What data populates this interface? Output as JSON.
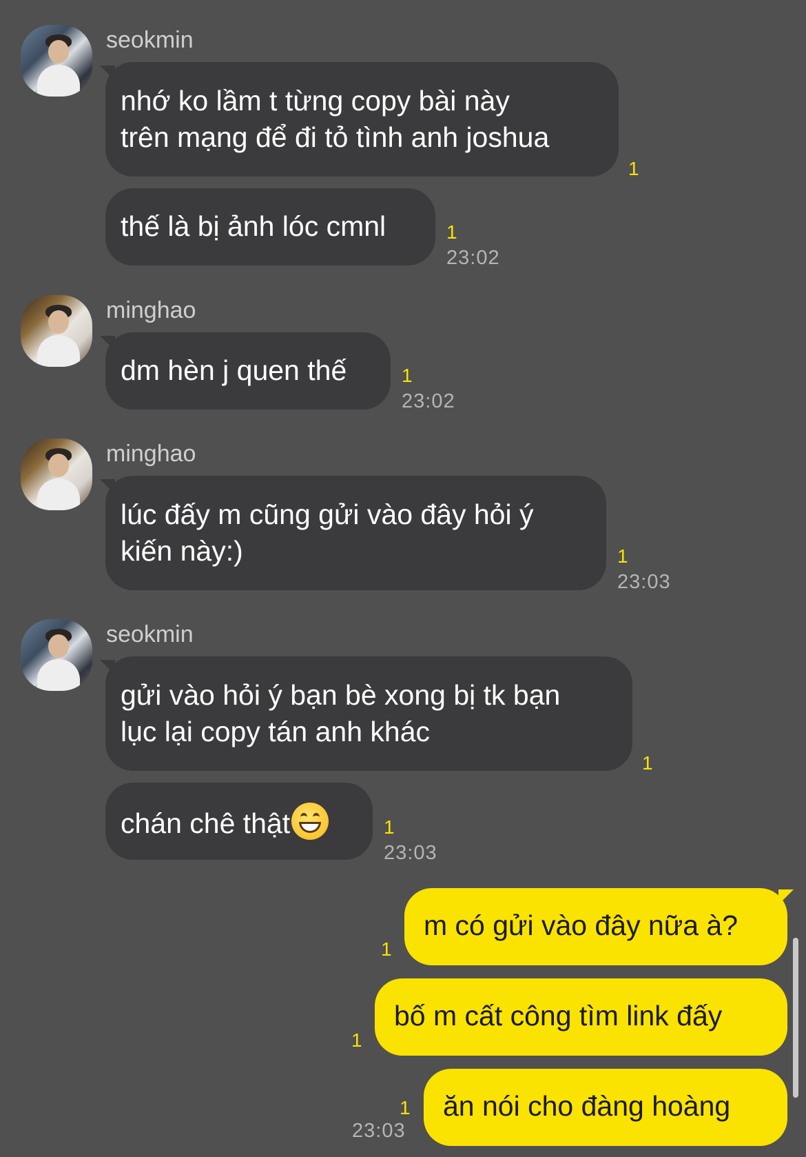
{
  "messages": [
    {
      "sender": "seokmin",
      "lines": [
        "nhớ ko lầm t từng copy bài này",
        "trên mạng để đi tỏ tình anh joshua"
      ],
      "read": "1"
    },
    {
      "lines": [
        "thế là bị ảnh lóc cmnl"
      ],
      "read": "1",
      "time": "23:02"
    },
    {
      "sender": "minghao",
      "lines": [
        "dm hèn j quen thế"
      ],
      "read": "1",
      "time": "23:02"
    },
    {
      "sender": "minghao",
      "lines": [
        "lúc đấy m cũng gửi vào đây hỏi ý",
        "kiến này:)"
      ],
      "read": "1",
      "time": "23:03"
    },
    {
      "sender": "seokmin",
      "lines": [
        "gửi vào hỏi ý bạn bè xong bị tk bạn",
        "lục lại copy tán anh khác"
      ],
      "read": "1"
    },
    {
      "text": "chán chê thật",
      "emoji": "grinning-face-emoji",
      "read": "1",
      "time": "23:03"
    }
  ],
  "outgoing": [
    {
      "text": "m có gửi vào đây nữa à?",
      "read": "1"
    },
    {
      "text": "bố m cất công tìm link đấy",
      "read": "1"
    },
    {
      "text": "ăn nói cho đàng hoàng",
      "read": "1",
      "time": "23:03"
    }
  ],
  "colors": {
    "background": "#505050",
    "incoming_bubble": "#3b3b3d",
    "outgoing_bubble": "#fae300",
    "read_count": "#fae300"
  }
}
